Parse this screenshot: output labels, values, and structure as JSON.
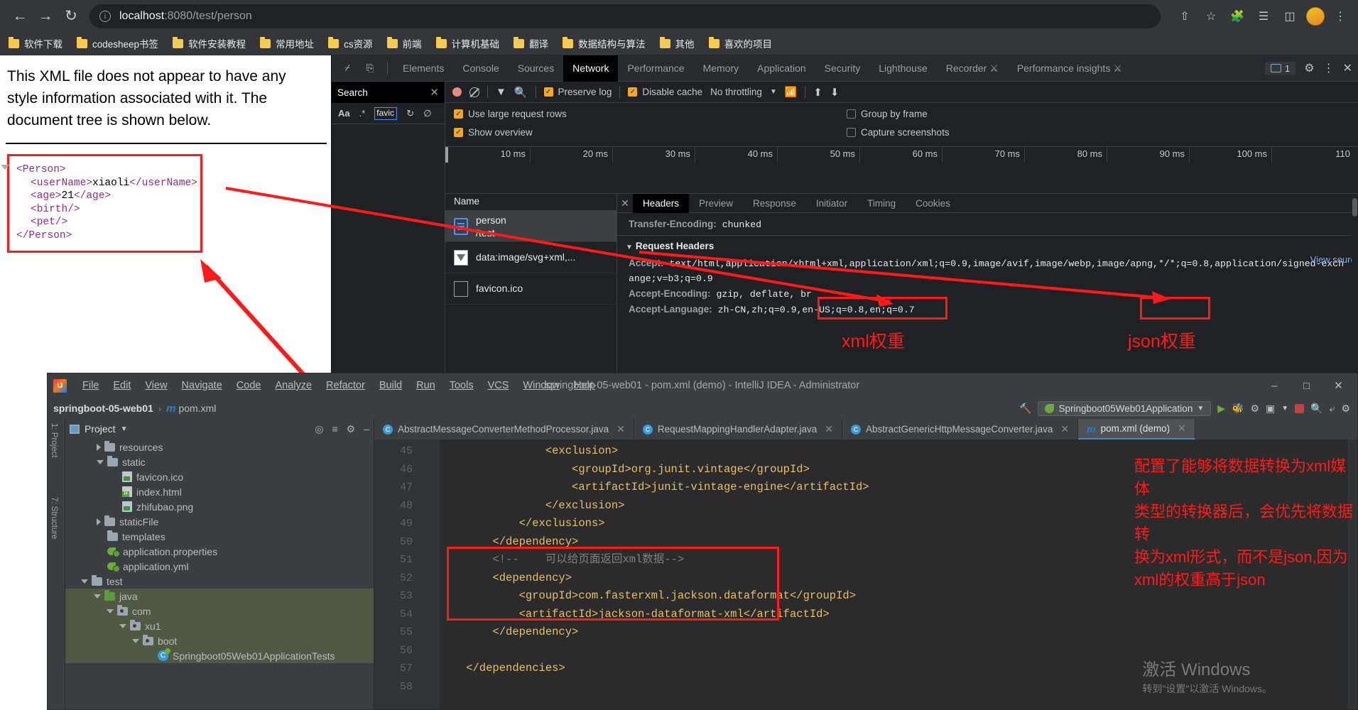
{
  "browser": {
    "back_icon": "back-arrow-icon",
    "forward_icon": "forward-arrow-icon",
    "reload_icon": "reload-icon",
    "url_host": "localhost",
    "url_rest": ":8080/test/person",
    "share_icon": "share-icon",
    "bookmark_icon": "star-icon",
    "extensions_icon": "puzzle-icon",
    "reading_list_icon": "reading-list-icon",
    "sidepanel_icon": "side-panel-icon",
    "menu_icon": "kebab-menu-icon",
    "bookmarks": [
      "软件下载",
      "codesheep书签",
      "软件安装教程",
      "常用地址",
      "cs资源",
      "前端",
      "计算机基础",
      "翻译",
      "数据结构与算法",
      "其他",
      "喜欢的项目"
    ]
  },
  "page": {
    "notice": "This XML file does not appear to have any style information associated with it. The document tree is shown below.",
    "xml": {
      "root_open": "<Person>",
      "root_close": "</Person>",
      "lines": [
        {
          "tag_open": "<userName>",
          "value": "xiaoli",
          "tag_close": "</userName>"
        },
        {
          "tag_open": "<age>",
          "value": "21",
          "tag_close": "</age>"
        },
        {
          "tag_open": "<birth/>",
          "value": "",
          "tag_close": ""
        },
        {
          "tag_open": "<pet/>",
          "value": "",
          "tag_close": ""
        }
      ]
    }
  },
  "devtools": {
    "inspect_icon": "inspect-element-icon",
    "device_icon": "device-toolbar-icon",
    "tabs": [
      "Elements",
      "Console",
      "Sources",
      "Network",
      "Performance",
      "Memory",
      "Application",
      "Security",
      "Lighthouse",
      "Recorder",
      "Performance insights"
    ],
    "active_tab": "Network",
    "recorder_beta_icon": "beta-flask-icon",
    "insights_beta_icon": "beta-flask-icon",
    "issues_count": "1",
    "issues_icon": "message-icon",
    "settings_icon": "gear-icon",
    "more_icon": "kebab-menu-icon",
    "close_icon": "close-icon",
    "search": {
      "title": "Search",
      "close_icon": "close-icon",
      "match_case_icon": "Aa",
      "regex_icon": ".*",
      "query": "favic",
      "refresh_icon": "refresh-icon",
      "clear_icon": "clear-icon"
    },
    "network_toolbar": {
      "record_icon": "record-icon",
      "clear_icon": "clear-icon",
      "filter_icon": "filter-icon",
      "search_icon": "search-icon",
      "preserve_log": {
        "label": "Preserve log",
        "checked": true
      },
      "disable_cache": {
        "label": "Disable cache",
        "checked": true
      },
      "throttling": "No throttling",
      "throttle_caret_icon": "chevron-down-icon",
      "wifi_icon": "network-conditions-icon",
      "import_icon": "import-har-icon",
      "export_icon": "export-har-icon"
    },
    "options": [
      {
        "label": "Use large request rows",
        "checked": true
      },
      {
        "label": "Show overview",
        "checked": true
      },
      {
        "label": "Group by frame",
        "checked": false
      },
      {
        "label": "Capture screenshots",
        "checked": false
      }
    ],
    "ruler_ticks": [
      "10 ms",
      "20 ms",
      "30 ms",
      "40 ms",
      "50 ms",
      "60 ms",
      "70 ms",
      "80 ms",
      "90 ms",
      "100 ms",
      "110"
    ],
    "requests": {
      "column_header": "Name",
      "rows": [
        {
          "name": "person",
          "sub": "/test",
          "icon": "document-icon",
          "selected": true
        },
        {
          "name": "data:image/svg+xml,...",
          "sub": "",
          "icon": "image-icon",
          "selected": false
        },
        {
          "name": "favicon.ico",
          "sub": "",
          "icon": "blank-file-icon",
          "selected": false
        }
      ]
    },
    "detail": {
      "close_icon": "close-icon",
      "tabs": [
        "Headers",
        "Preview",
        "Response",
        "Initiator",
        "Timing",
        "Cookies"
      ],
      "active_tab": "Headers",
      "view_source": "View sourc",
      "transfer_encoding_key": "Transfer-Encoding:",
      "transfer_encoding_value": "chunked",
      "request_headers_title": "Request Headers",
      "accept_key": "Accept:",
      "accept_part1": "text/html,application/xhtml+xml,",
      "accept_xml": "application/xml;q=0.9",
      "accept_part2": ",image/avif,image/webp,image/apng,",
      "accept_json": "*/*;q=0.8",
      "accept_part3": ",application/signed-exch",
      "accept_wrap": "ange;v=b3;q=0.9",
      "accept_encoding_key": "Accept-Encoding:",
      "accept_encoding_value": "gzip, deflate, br",
      "accept_language_key": "Accept-Language:",
      "accept_language_value": "zh-CN,zh;q=0.9,en-US;q=0.8,en;q=0.7"
    }
  },
  "annotations": {
    "xml_weight": "xml权重",
    "json_weight": "json权重",
    "ide_note": "配置了能够将数据转换为xml媒体\n类型的转换器后，会优先将数据转\n换为xml形式，而不是json,因为\nxml的权重高于json"
  },
  "idea": {
    "logo_icon": "intellij-logo-icon",
    "menu": [
      "File",
      "Edit",
      "View",
      "Navigate",
      "Code",
      "Analyze",
      "Refactor",
      "Build",
      "Run",
      "Tools",
      "VCS",
      "Window",
      "Help"
    ],
    "title": "springboot-05-web01 - pom.xml (demo) - IntelliJ IDEA - Administrator",
    "window_minimize_icon": "minimize-icon",
    "window_maximize_icon": "maximize-icon",
    "window_close_icon": "close-icon",
    "breadcrumb_project": "springboot-05-web01",
    "breadcrumb_sep": "›",
    "breadcrumb_maven_icon": "m",
    "breadcrumb_file": "pom.xml",
    "hammer_icon": "build-icon",
    "run_config": "Springboot05Web01Application",
    "run_config_icon": "spring-leaf-icon",
    "run_config_caret_icon": "chevron-down-icon",
    "run_icon": "run-icon",
    "debug_icon": "debug-icon",
    "profile_icon": "profile-icon",
    "coverage_icon": "coverage-icon",
    "stop_icon": "stop-icon",
    "search_everywhere_icon": "search-icon",
    "git_icon": "git-icon",
    "settings_icon": "gear-icon",
    "rails": [
      "1: Project",
      "7: Structure"
    ],
    "project_pane": {
      "title": "Project",
      "caret_icon": "chevron-down-icon",
      "locate_icon": "locate-icon",
      "collapse_icon": "collapse-all-icon",
      "gear_icon": "gear-icon",
      "hide_icon": "hide-icon",
      "tree": [
        {
          "label": "resources",
          "indent": 3,
          "arrow": "right",
          "icon": "folder",
          "selected": false
        },
        {
          "label": "static",
          "indent": 3,
          "arrow": "down",
          "icon": "folder",
          "selected": false
        },
        {
          "label": "favicon.ico",
          "indent": 5,
          "arrow": "none",
          "icon": "image-file",
          "selected": false
        },
        {
          "label": "index.html",
          "indent": 5,
          "arrow": "none",
          "icon": "html-file",
          "selected": false
        },
        {
          "label": "zhifubao.png",
          "indent": 5,
          "arrow": "none",
          "icon": "image-file",
          "selected": false
        },
        {
          "label": "staticFile",
          "indent": 3,
          "arrow": "right",
          "icon": "folder",
          "selected": false
        },
        {
          "label": "templates",
          "indent": 3,
          "arrow": "none",
          "icon": "folder",
          "selected": false
        },
        {
          "label": "application.properties",
          "indent": 3,
          "arrow": "none",
          "icon": "spring-file",
          "selected": false
        },
        {
          "label": "application.yml",
          "indent": 3,
          "arrow": "none",
          "icon": "spring-file",
          "selected": false
        },
        {
          "label": "test",
          "indent": 1,
          "arrow": "down",
          "icon": "folder",
          "selected": false
        },
        {
          "label": "java",
          "indent": 2,
          "arrow": "down",
          "icon": "folder-green",
          "selected": true
        },
        {
          "label": "com",
          "indent": 3,
          "arrow": "down",
          "icon": "package",
          "selected": true
        },
        {
          "label": "xu1",
          "indent": 4,
          "arrow": "down",
          "icon": "package",
          "selected": true
        },
        {
          "label": "boot",
          "indent": 5,
          "arrow": "down",
          "icon": "package",
          "selected": true
        },
        {
          "label": "Springboot05Web01ApplicationTests",
          "indent": 6,
          "arrow": "none",
          "icon": "test-class",
          "selected": true
        }
      ]
    },
    "editor_tabs": [
      {
        "label": "AbstractMessageConverterMethodProcessor.java",
        "icon": "java-class-icon",
        "active": false
      },
      {
        "label": "RequestMappingHandlerAdapter.java",
        "icon": "java-class-icon",
        "active": false
      },
      {
        "label": "AbstractGenericHttpMessageConverter.java",
        "icon": "java-class-icon",
        "active": false
      },
      {
        "label": "pom.xml (demo)",
        "icon": "maven-icon",
        "active": true
      }
    ],
    "code": [
      {
        "num": "45",
        "text": "                <exclusion>",
        "kind": "tag"
      },
      {
        "num": "46",
        "text": "                    <groupId>org.junit.vintage</groupId>",
        "kind": "tag"
      },
      {
        "num": "47",
        "text": "                    <artifactId>junit-vintage-engine</artifactId>",
        "kind": "tag"
      },
      {
        "num": "48",
        "text": "                </exclusion>",
        "kind": "tag"
      },
      {
        "num": "49",
        "text": "            </exclusions>",
        "kind": "tag"
      },
      {
        "num": "50",
        "text": "        </dependency>",
        "kind": "tag"
      },
      {
        "num": "51",
        "text": "        <!--    可以给页面返回xml数据-->",
        "kind": "comment"
      },
      {
        "num": "52",
        "text": "        <dependency>",
        "kind": "tag"
      },
      {
        "num": "53",
        "text": "            <groupId>com.fasterxml.jackson.dataformat</groupId>",
        "kind": "tag"
      },
      {
        "num": "54",
        "text": "            <artifactId>jackson-dataformat-xml</artifactId>",
        "kind": "tag"
      },
      {
        "num": "55",
        "text": "        </dependency>",
        "kind": "tag"
      },
      {
        "num": "56",
        "text": "",
        "kind": "tag"
      },
      {
        "num": "57",
        "text": "    </dependencies>",
        "kind": "tag"
      },
      {
        "num": "58",
        "text": "",
        "kind": "tag"
      }
    ],
    "watermark_line1": "激活 Windows",
    "watermark_line2": "转到\"设置\"以激活 Windows。"
  }
}
